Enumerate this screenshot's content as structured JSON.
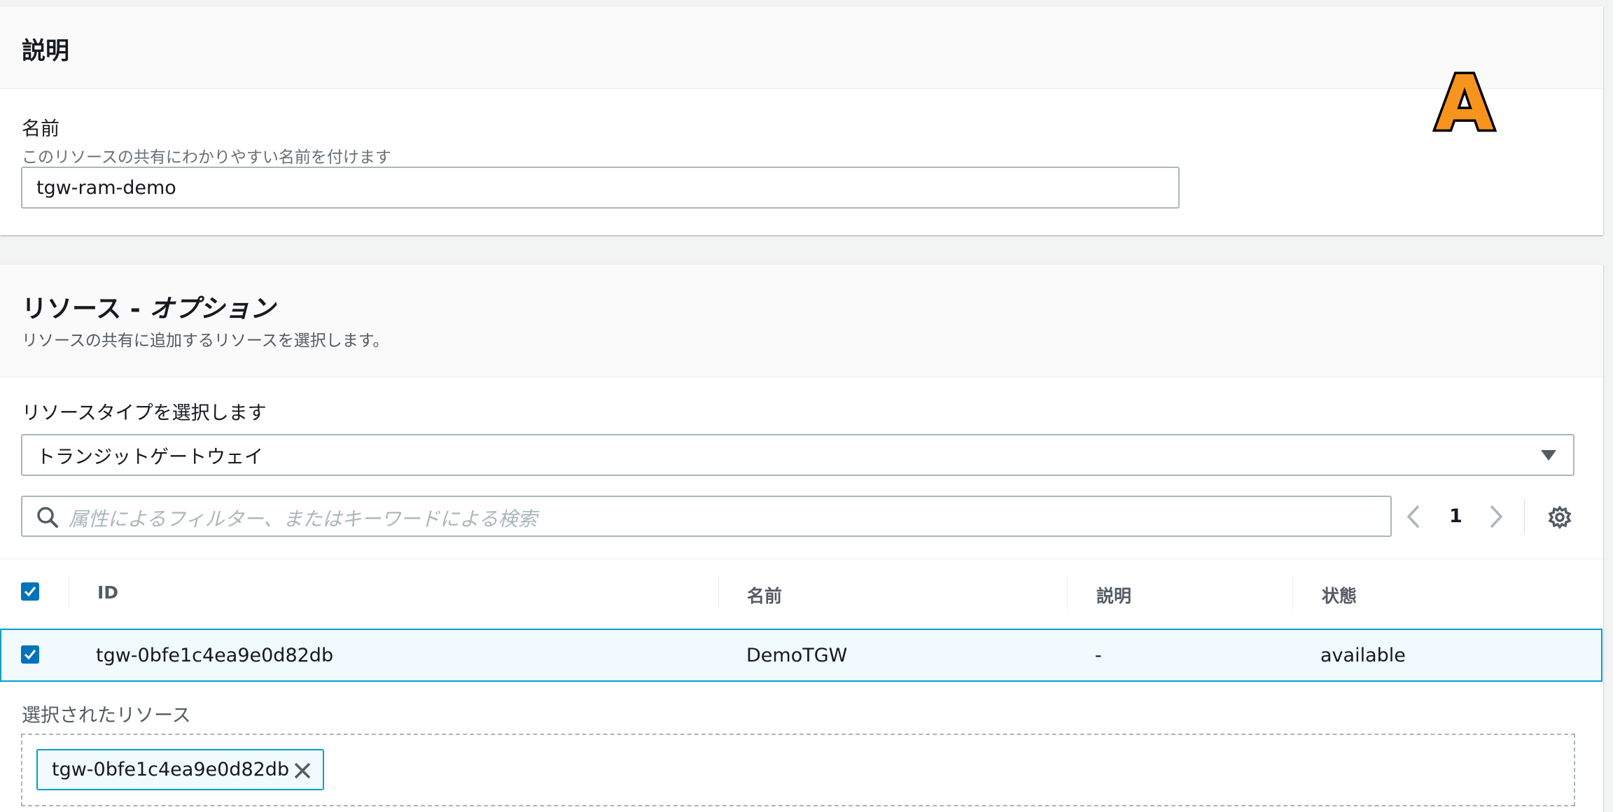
{
  "description_panel": {
    "title": "説明",
    "name_label": "名前",
    "name_hint": "このリソースの共有にわかりやすい名前を付けます",
    "name_value": "tgw-ram-demo",
    "badge": "A"
  },
  "resources_panel": {
    "title_main": "リソース - ",
    "title_italic": "オプション",
    "subtitle": "リソースの共有に追加するリソースを選択します。",
    "type_label": "リソースタイプを選択します",
    "type_selected": "トランジットゲートウェイ",
    "search_placeholder": "属性によるフィルター、またはキーワードによる検索",
    "page_number": "1",
    "table": {
      "headers": [
        "ID",
        "名前",
        "説明",
        "状態"
      ],
      "rows": [
        {
          "id": "tgw-0bfe1c4ea9e0d82db",
          "name": "DemoTGW",
          "description": "-",
          "state": "available"
        }
      ]
    },
    "selected_label": "選択されたリソース",
    "selected_tokens": [
      "tgw-0bfe1c4ea9e0d82db"
    ]
  },
  "colors": {
    "accent": "#0073bb",
    "badge": "#f7941d",
    "selection_border": "#00a1c9"
  }
}
